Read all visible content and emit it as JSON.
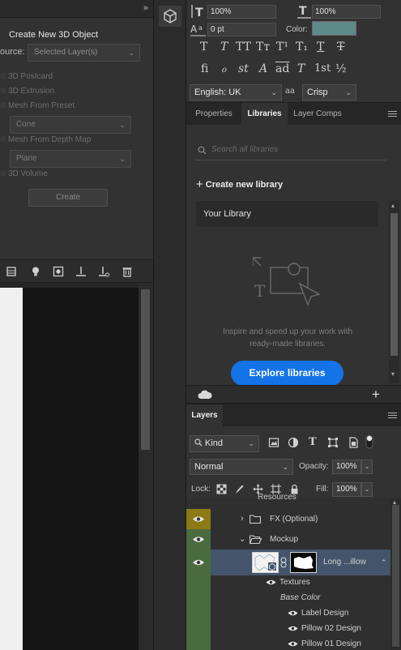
{
  "three_d_panel": {
    "title": "Create New 3D Object",
    "source_label": "ource:",
    "source_value": "Selected Layer(s)",
    "options": [
      "3D Postcard",
      "3D Extrusion",
      "Mesh From Preset",
      "Mesh From Depth Map",
      "3D Volume"
    ],
    "preset_value": "Cone",
    "depth_map_value": "Plane",
    "create_label": "Create"
  },
  "character": {
    "vertical_scale": "100%",
    "horizontal_scale": "100%",
    "baseline_shift": "0 pt",
    "color_label": "Color:",
    "color_swatch": "#5e8a89",
    "style_glyphs": [
      "T",
      "T",
      "TT",
      "Tт",
      "T¹",
      "T₁",
      "T",
      "T"
    ],
    "opentype_glyphs": [
      "fi",
      "ℴ",
      "st",
      "A",
      "ad",
      "T",
      "1st",
      "½"
    ],
    "language": "English: UK",
    "aa_icon": "aa",
    "antialias": "Crisp"
  },
  "libraries": {
    "tabs": [
      "Properties",
      "Libraries",
      "Layer Comps"
    ],
    "active_tab": "Libraries",
    "search_placeholder": "Search all libraries",
    "create_new": "Create new library",
    "library_name": "Your Library",
    "promo_line1": "Inspire and speed up your work with",
    "promo_line2": "ready-made libraries.",
    "explore_button": "Explore libraries"
  },
  "layers": {
    "tab": "Layers",
    "filter_kind": "Kind",
    "blend_mode": "Normal",
    "opacity_label": "Opacity:",
    "opacity_value": "100%",
    "lock_label": "Lock:",
    "fill_label": "Fill:",
    "fill_value": "100%",
    "partial_row": "Resources",
    "rows": [
      {
        "name": "FX (Optional)",
        "type": "group",
        "eye_color": "#8c7a14"
      },
      {
        "name": "Mockup",
        "type": "group-open",
        "eye_color": "#4a6b3e"
      },
      {
        "name": "Long ...illow",
        "type": "smart-object",
        "eye_color": "#4a6b3e",
        "selected": true
      },
      {
        "name": "Textures",
        "type": "effects"
      },
      {
        "name": "Base Color",
        "type": "filters-label"
      },
      {
        "name": "Label Design",
        "type": "effect-item"
      },
      {
        "name": "Pillow 02 Design",
        "type": "effect-item"
      },
      {
        "name": "Pillow 01 Design",
        "type": "effect-item"
      }
    ]
  }
}
